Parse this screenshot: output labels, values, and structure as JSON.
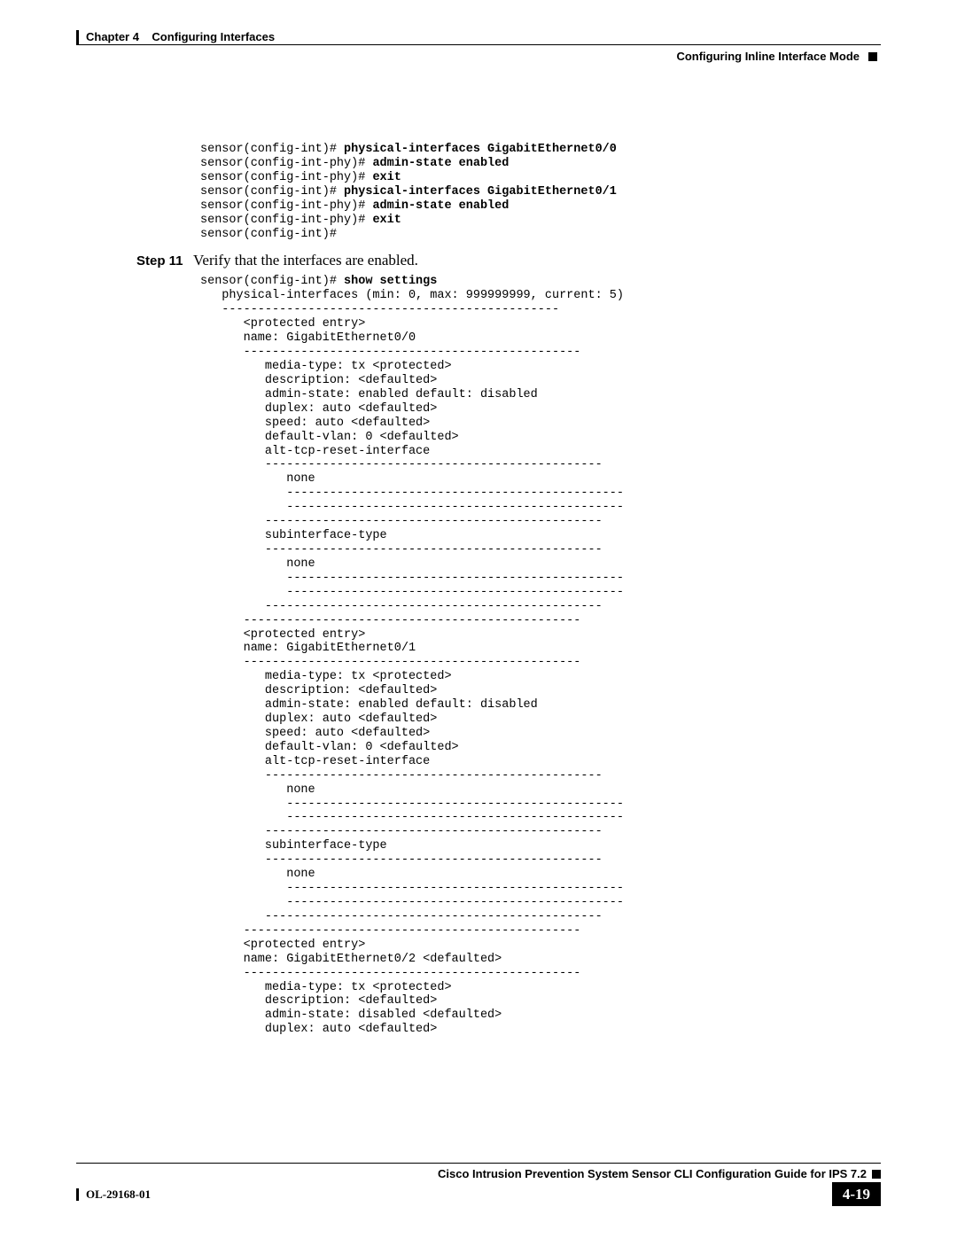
{
  "header": {
    "chapter_label": "Chapter 4",
    "chapter_title": "Configuring Interfaces",
    "section_title": "Configuring Inline Interface Mode"
  },
  "code_block_1": {
    "l1_pre": "sensor(config-int)# ",
    "l1_cmd": "physical-interfaces GigabitEthernet0/0",
    "l2_pre": "sensor(config-int-phy)# ",
    "l2_cmd": "admin-state enabled",
    "l3_pre": "sensor(config-int-phy)# ",
    "l3_cmd": "exit",
    "l4_pre": "sensor(config-int)# ",
    "l4_cmd": "physical-interfaces GigabitEthernet0/1",
    "l5_pre": "sensor(config-int-phy)# ",
    "l5_cmd": "admin-state enabled",
    "l6_pre": "sensor(config-int-phy)# ",
    "l6_cmd": "exit",
    "l7": "sensor(config-int)#"
  },
  "step": {
    "label": "Step 11",
    "text": "Verify that the interfaces are enabled."
  },
  "code_block_2": {
    "l01_pre": "sensor(config-int)# ",
    "l01_cmd": "show settings",
    "l02": "   physical-interfaces (min: 0, max: 999999999, current: 5)",
    "l03": "   -----------------------------------------------",
    "l04": "      <protected entry>",
    "l05": "      name: GigabitEthernet0/0",
    "l06": "      -----------------------------------------------",
    "l07": "         media-type: tx <protected>",
    "l08": "         description: <defaulted>",
    "l09": "         admin-state: enabled default: disabled",
    "l10": "         duplex: auto <defaulted>",
    "l11": "         speed: auto <defaulted>",
    "l12": "         default-vlan: 0 <defaulted>",
    "l13": "         alt-tcp-reset-interface",
    "l14": "         -----------------------------------------------",
    "l15": "            none",
    "l16": "            -----------------------------------------------",
    "l17": "            -----------------------------------------------",
    "l18": "         -----------------------------------------------",
    "l19": "         subinterface-type",
    "l20": "         -----------------------------------------------",
    "l21": "            none",
    "l22": "            -----------------------------------------------",
    "l23": "            -----------------------------------------------",
    "l24": "         -----------------------------------------------",
    "l25": "      -----------------------------------------------",
    "l26": "      <protected entry>",
    "l27": "      name: GigabitEthernet0/1",
    "l28": "      -----------------------------------------------",
    "l29": "         media-type: tx <protected>",
    "l30": "         description: <defaulted>",
    "l31": "         admin-state: enabled default: disabled",
    "l32": "         duplex: auto <defaulted>",
    "l33": "         speed: auto <defaulted>",
    "l34": "         default-vlan: 0 <defaulted>",
    "l35": "         alt-tcp-reset-interface",
    "l36": "         -----------------------------------------------",
    "l37": "            none",
    "l38": "            -----------------------------------------------",
    "l39": "            -----------------------------------------------",
    "l40": "         -----------------------------------------------",
    "l41": "         subinterface-type",
    "l42": "         -----------------------------------------------",
    "l43": "            none",
    "l44": "            -----------------------------------------------",
    "l45": "            -----------------------------------------------",
    "l46": "         -----------------------------------------------",
    "l47": "      -----------------------------------------------",
    "l48": "      <protected entry>",
    "l49": "      name: GigabitEthernet0/2 <defaulted>",
    "l50": "      -----------------------------------------------",
    "l51": "         media-type: tx <protected>",
    "l52": "         description: <defaulted>",
    "l53": "         admin-state: disabled <defaulted>",
    "l54": "         duplex: auto <defaulted>"
  },
  "footer": {
    "book_title": "Cisco Intrusion Prevention System Sensor CLI Configuration Guide for IPS 7.2",
    "doc_id": "OL-29168-01",
    "page_number": "4-19"
  }
}
